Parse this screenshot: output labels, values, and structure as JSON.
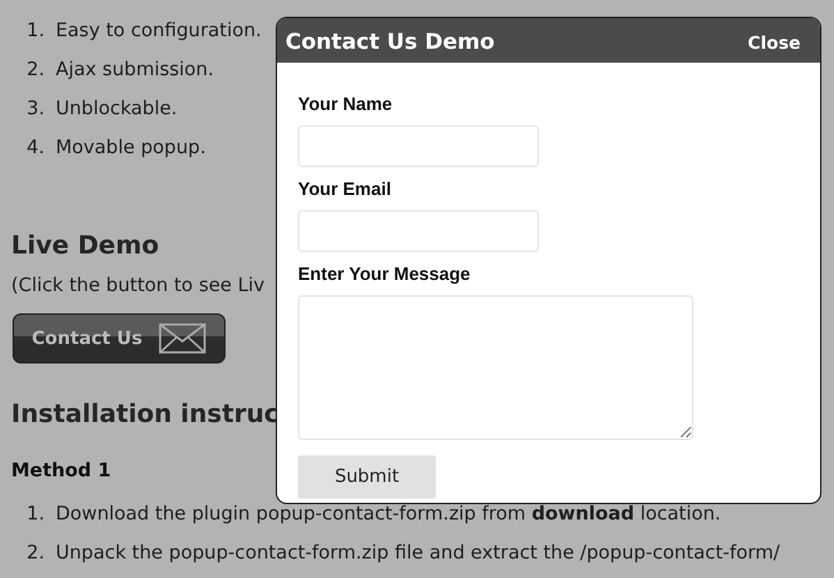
{
  "features": [
    {
      "number": "1.",
      "text": "Easy to configuration."
    },
    {
      "number": "2.",
      "text": "Ajax submission."
    },
    {
      "number": "3.",
      "text": "Unblockable."
    },
    {
      "number": "4.",
      "text": "Movable popup."
    }
  ],
  "live_demo": {
    "heading": "Live Demo",
    "note": "(Click the button to see Liv",
    "button": "Contact Us"
  },
  "installation": {
    "heading": "Installation instruc",
    "method": "Method 1",
    "steps": [
      {
        "number": "1.",
        "text": "Download the plugin popup-contact-form.zip from **download** location."
      },
      {
        "number": "2.",
        "text": "Unpack the popup-contact-form.zip file and extract the /popup-contact-form/"
      }
    ]
  },
  "popup": {
    "title": "Contact Us Demo",
    "close": "Close",
    "fields": [
      {
        "label": "Your Name",
        "kind": "input"
      },
      {
        "label": "Your Email",
        "kind": "input"
      },
      {
        "label": "Enter Your Message",
        "kind": "textarea"
      }
    ],
    "submit": "Submit"
  }
}
